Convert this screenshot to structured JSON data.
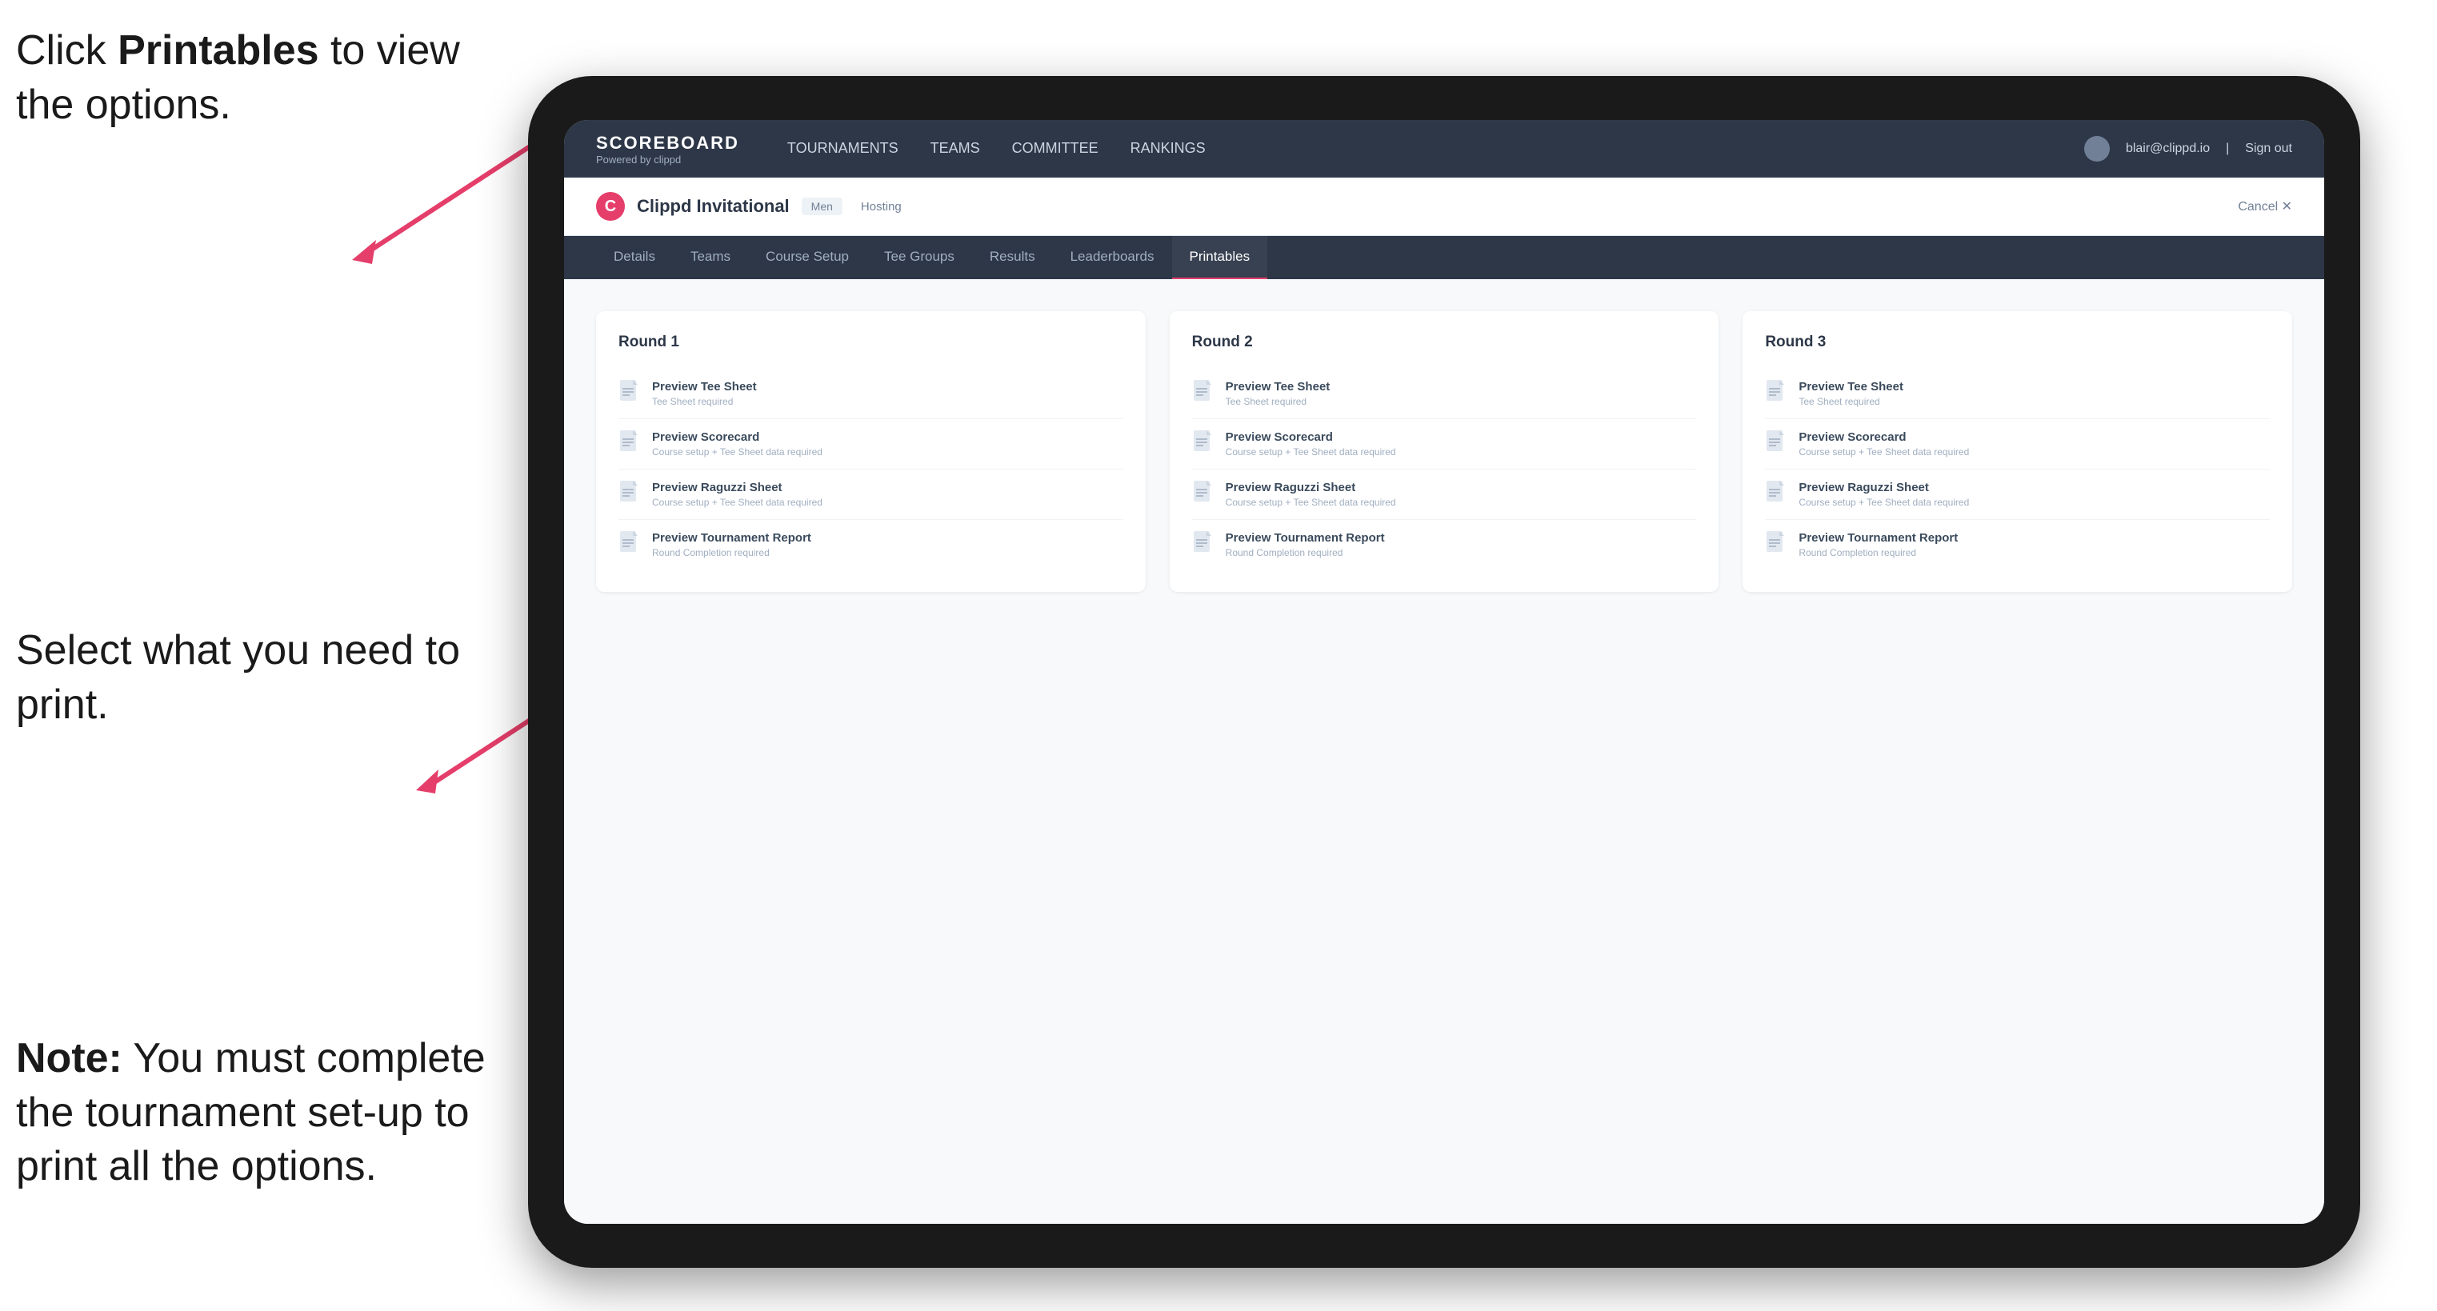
{
  "annotations": {
    "annotation1": "Click <strong>Printables</strong> to view the options.",
    "annotation1_plain": "Click Printables to view the options.",
    "annotation1_bold": "Printables",
    "annotation2_line1": "Select what you",
    "annotation2_line2": "need to print.",
    "annotation3_note": "Note:",
    "annotation3_rest": " You must complete the tournament set-up to print all the options."
  },
  "top_nav": {
    "brand": "SCOREBOARD",
    "brand_sub": "Powered by clippd",
    "items": [
      {
        "label": "TOURNAMENTS",
        "active": false
      },
      {
        "label": "TEAMS",
        "active": false
      },
      {
        "label": "COMMITTEE",
        "active": false
      },
      {
        "label": "RANKINGS",
        "active": false
      }
    ],
    "user_email": "blair@clippd.io",
    "sign_out": "Sign out"
  },
  "tournament_header": {
    "logo_letter": "C",
    "name": "Clippd Invitational",
    "badge": "Men",
    "status": "Hosting",
    "cancel": "Cancel ✕"
  },
  "sub_nav": {
    "items": [
      {
        "label": "Details",
        "active": false
      },
      {
        "label": "Teams",
        "active": false
      },
      {
        "label": "Course Setup",
        "active": false
      },
      {
        "label": "Tee Groups",
        "active": false
      },
      {
        "label": "Results",
        "active": false
      },
      {
        "label": "Leaderboards",
        "active": false
      },
      {
        "label": "Printables",
        "active": true
      }
    ]
  },
  "rounds": [
    {
      "title": "Round 1",
      "items": [
        {
          "title": "Preview Tee Sheet",
          "subtitle": "Tee Sheet required"
        },
        {
          "title": "Preview Scorecard",
          "subtitle": "Course setup + Tee Sheet data required"
        },
        {
          "title": "Preview Raguzzi Sheet",
          "subtitle": "Course setup + Tee Sheet data required"
        },
        {
          "title": "Preview Tournament Report",
          "subtitle": "Round Completion required"
        }
      ]
    },
    {
      "title": "Round 2",
      "items": [
        {
          "title": "Preview Tee Sheet",
          "subtitle": "Tee Sheet required"
        },
        {
          "title": "Preview Scorecard",
          "subtitle": "Course setup + Tee Sheet data required"
        },
        {
          "title": "Preview Raguzzi Sheet",
          "subtitle": "Course setup + Tee Sheet data required"
        },
        {
          "title": "Preview Tournament Report",
          "subtitle": "Round Completion required"
        }
      ]
    },
    {
      "title": "Round 3",
      "items": [
        {
          "title": "Preview Tee Sheet",
          "subtitle": "Tee Sheet required"
        },
        {
          "title": "Preview Scorecard",
          "subtitle": "Course setup + Tee Sheet data required"
        },
        {
          "title": "Preview Raguzzi Sheet",
          "subtitle": "Course setup + Tee Sheet data required"
        },
        {
          "title": "Preview Tournament Report",
          "subtitle": "Round Completion required"
        }
      ]
    }
  ]
}
